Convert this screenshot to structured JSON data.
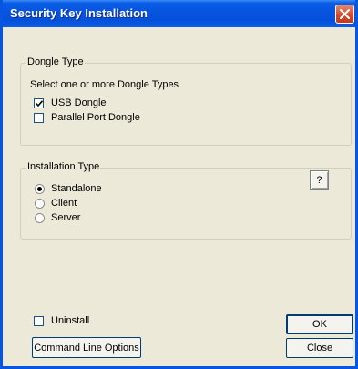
{
  "window": {
    "title": "Security Key Installation"
  },
  "dongle_type": {
    "title": "Dongle Type",
    "instruction": "Select one or more Dongle Types",
    "options": [
      {
        "label": "USB Dongle",
        "checked": true
      },
      {
        "label": "Parallel Port Dongle",
        "checked": false
      }
    ]
  },
  "installation_type": {
    "title": "Installation Type",
    "help_label": "?",
    "options": [
      {
        "label": "Standalone",
        "selected": true
      },
      {
        "label": "Client",
        "selected": false
      },
      {
        "label": "Server",
        "selected": false
      }
    ]
  },
  "uninstall": {
    "label": "Uninstall",
    "checked": false
  },
  "buttons": {
    "command_line": "Command Line Options",
    "ok": "OK",
    "close": "Close"
  },
  "icons": {
    "close": "close-icon",
    "check": "checkmark-icon"
  },
  "colors": {
    "titlebar": "#0654e0",
    "close_button": "#d8472a",
    "dialog_bg": "#ece9d8"
  }
}
